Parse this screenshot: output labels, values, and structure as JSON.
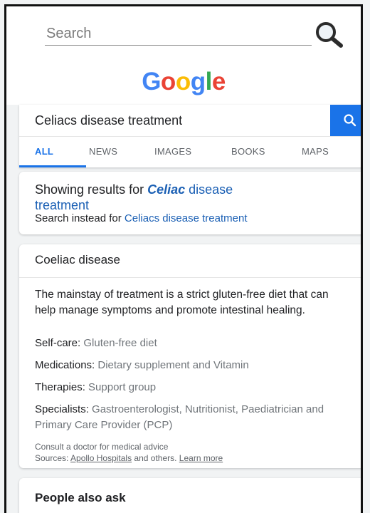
{
  "top_search": {
    "placeholder": "Search"
  },
  "logo": {
    "letters": [
      "G",
      "o",
      "o",
      "g",
      "l",
      "e"
    ],
    "colors": [
      "#4285f4",
      "#ea4335",
      "#fbbc05",
      "#4285f4",
      "#34a853",
      "#ea4335"
    ]
  },
  "query": {
    "value": "Celiacs disease treatment"
  },
  "tabs": [
    "ALL",
    "NEWS",
    "IMAGES",
    "BOOKS",
    "MAPS"
  ],
  "spell": {
    "prefix": "Showing results for ",
    "corrected_word": "Celiac",
    "corrected_rest": " disease",
    "corrected_line2": "treatment",
    "instead_prefix": "Search instead for ",
    "instead_query": "Celiacs disease treatment"
  },
  "knowledge_panel": {
    "title": "Coeliac disease",
    "description": "The mainstay of treatment is a strict gluten-free diet that can help manage symptoms and promote intestinal healing.",
    "rows": [
      {
        "key": "Self-care: ",
        "value": "Gluten-free diet"
      },
      {
        "key": "Medications: ",
        "value": "Dietary supplement and Vitamin"
      },
      {
        "key": "Therapies: ",
        "value": "Support group"
      },
      {
        "key": "Specialists: ",
        "value": "Gastroenterologist, Nutritionist, Paediatrician and Primary Care Provider (PCP)"
      }
    ],
    "consult": "Consult a doctor for medical advice",
    "sources_prefix": "Sources: ",
    "sources_link": "Apollo Hospitals",
    "sources_mid": " and others. ",
    "learn_more": "Learn more"
  },
  "people_also_ask": {
    "title": "People also ask"
  },
  "colors": {
    "accent": "#1a73e8",
    "link": "#1a5fb4"
  },
  "icons": {
    "top_search": "magnifier-icon",
    "query_search": "search-icon"
  }
}
